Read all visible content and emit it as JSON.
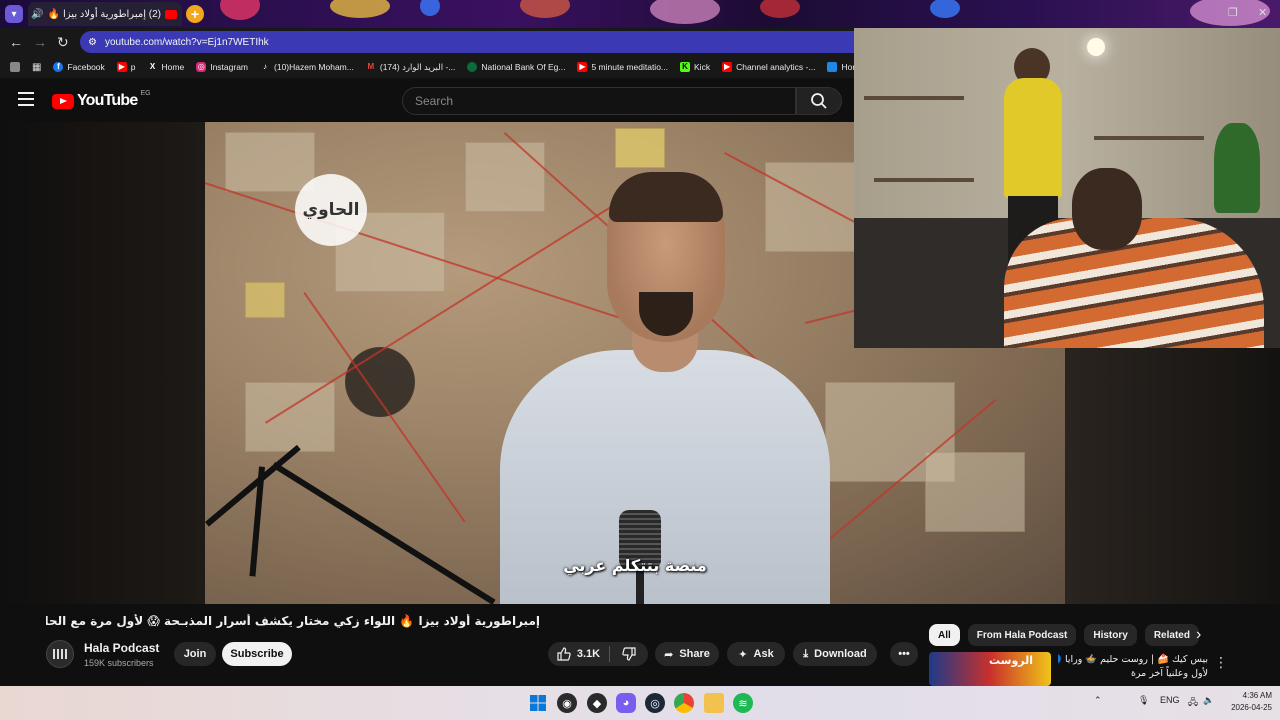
{
  "browser": {
    "tab_title": "(2) إمبراطورية أولاد بيزا 🔥",
    "url": "youtube.com/watch?v=Ej1n7WETIhk"
  },
  "bookmarks": [
    {
      "label": "Facebook",
      "icon": "facebook-icon",
      "color": "#1877f2"
    },
    {
      "label": "p",
      "icon": "youtube-icon",
      "color": "#ff0000"
    },
    {
      "label": "Home",
      "icon": "x-icon",
      "color": "#000000"
    },
    {
      "label": "Instagram",
      "icon": "instagram-icon",
      "color": "#d62976"
    },
    {
      "label": "(10)Hazem Moham...",
      "icon": "tiktok-icon",
      "color": "#111111"
    },
    {
      "label": "(174) البريد الوارد -...",
      "icon": "gmail-icon",
      "color": "#ea4335"
    },
    {
      "label": "National Bank Of Eg...",
      "icon": "bank-icon",
      "color": "#0b6b3a"
    },
    {
      "label": "5 minute meditatio...",
      "icon": "youtube-icon",
      "color": "#ff0000"
    },
    {
      "label": "Kick",
      "icon": "kick-icon",
      "color": "#53fc18"
    },
    {
      "label": "Channel analytics -...",
      "icon": "youtube-icon",
      "color": "#ff0000"
    },
    {
      "label": "Home -",
      "icon": "sheets-icon",
      "color": "#1e88e5"
    }
  ],
  "youtube": {
    "logo_text": "YouTube",
    "country_code": "EG",
    "search_placeholder": "Search"
  },
  "video": {
    "channel_watermark": "الحاوي",
    "subtitle": "منصة بتتكلم عربي",
    "title": "إمبراطورية أولاد بيزا 🔥 اللواء زكي مختار يكشف أسرار المذبـحة 😱 لأول مرة مع الحاوي وليد بريك",
    "channel_name": "Hala Podcast",
    "subscribers": "159K subscribers",
    "join_label": "Join",
    "subscribe_label": "Subscribe",
    "likes": "3.1K",
    "share_label": "Share",
    "ask_label": "Ask",
    "download_label": "Download"
  },
  "sidebar": {
    "chips": [
      "All",
      "From Hala Podcast",
      "History",
      "Related"
    ],
    "active_chip": "All",
    "rec_thumb_text": "الروست",
    "rec_title_line1": "بيس كيك 🍰 | روست حليم 🍲 ورايا 🔵",
    "rec_title_line2": "لأول وعلنياً آخر مرة"
  },
  "taskbar": {
    "language": "ENG",
    "time": "4:36 AM",
    "date": "2026-04-25"
  }
}
